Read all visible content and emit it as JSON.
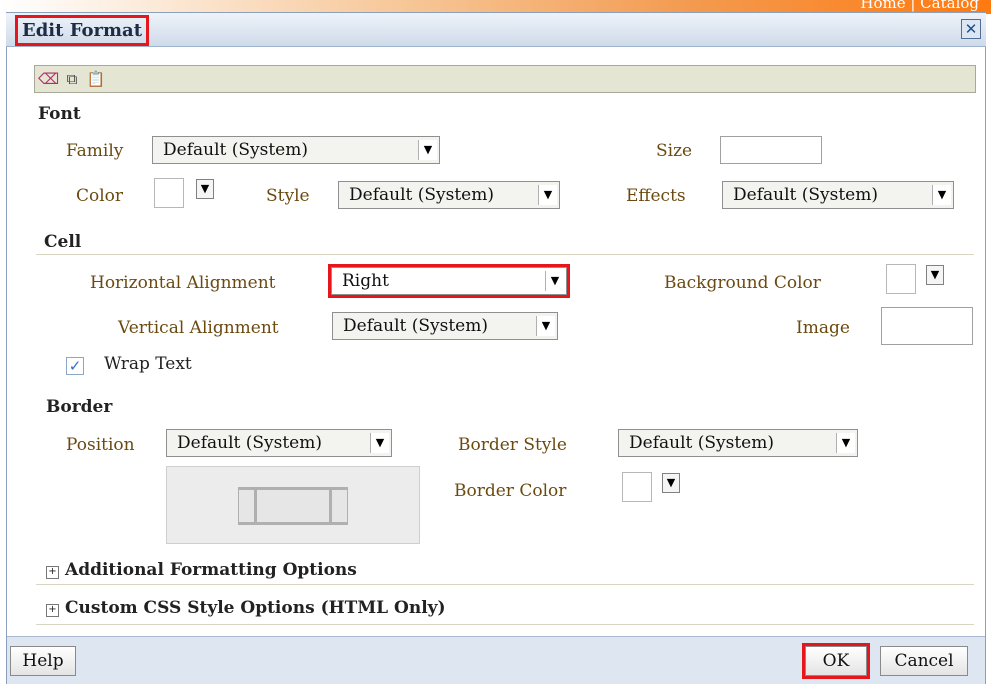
{
  "header_links": "Home  |  Catalog",
  "dialog": {
    "title": "Edit Format",
    "close_icon": "close-icon",
    "toolbar_icons": [
      "eraser-icon",
      "copy-icon",
      "paste-icon"
    ]
  },
  "font": {
    "heading": "Font",
    "family_label": "Family",
    "family_value": "Default (System)",
    "size_label": "Size",
    "size_value": "",
    "color_label": "Color",
    "style_label": "Style",
    "style_value": "Default (System)",
    "effects_label": "Effects",
    "effects_value": "Default (System)"
  },
  "cell": {
    "heading": "Cell",
    "h_align_label": "Horizontal Alignment",
    "h_align_value": "Right",
    "bg_color_label": "Background Color",
    "v_align_label": "Vertical Alignment",
    "v_align_value": "Default (System)",
    "image_label": "Image",
    "wrap_label": "Wrap Text",
    "wrap_checked": true
  },
  "border": {
    "heading": "Border",
    "position_label": "Position",
    "position_value": "Default (System)",
    "style_label": "Border Style",
    "style_value": "Default (System)",
    "color_label": "Border Color"
  },
  "expanders": {
    "additional": "Additional Formatting Options",
    "custom_css": "Custom CSS Style Options (HTML Only)"
  },
  "footer": {
    "help": "Help",
    "ok": "OK",
    "cancel": "Cancel"
  },
  "colors": {
    "highlight": "#e3171c",
    "label_brown": "#6b4a10",
    "title_bar": "#cfdbe9",
    "toolbar_bg": "#e5e5d3"
  }
}
